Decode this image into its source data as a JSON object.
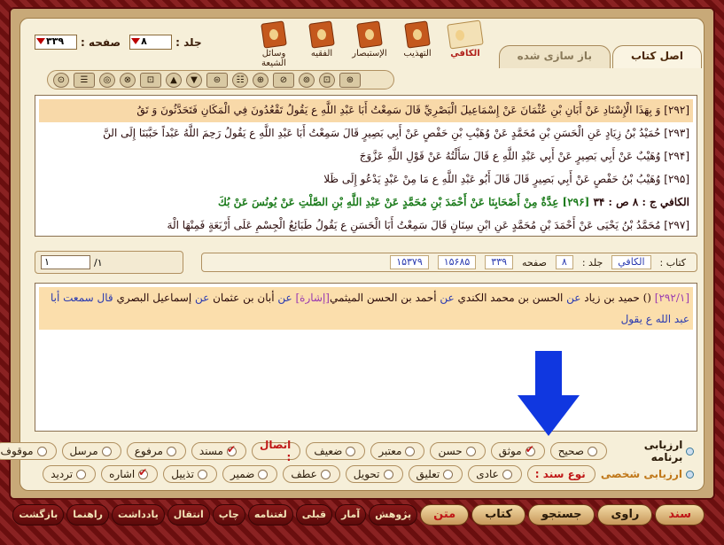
{
  "header": {
    "volume_label": "جلد :",
    "volume_value": "۸",
    "page_label": "صفحه :",
    "page_value": "۳۳۹",
    "books": [
      {
        "label": "الكافي",
        "active": true
      },
      {
        "label": "التهذيب",
        "active": false
      },
      {
        "label": "الإستبصار",
        "active": false
      },
      {
        "label": "الفقيه",
        "active": false
      },
      {
        "label": "وسائل الشيعة",
        "active": false
      }
    ],
    "tabs": [
      {
        "label": "اصل كتاب",
        "active": true
      },
      {
        "label": "باز سازی شده",
        "active": false
      }
    ]
  },
  "toolbar": {
    "buttons": [
      "⊙",
      "☰",
      "◎",
      "⊗",
      "⊡",
      "▲",
      "▼",
      "⊜",
      "☷",
      "⊕",
      "⊘",
      "⊚",
      "⊡",
      "⊛"
    ]
  },
  "hadith_lines": [
    {
      "num": "[۲۹۲]",
      "text": "وَ بِهَذَا الْإِسْنَادِ عَنْ أَبَانِ بْنِ عُثْمَانَ عَنْ إِسْمَاعِيلَ الْبَصْرِيِّ قَالَ سَمِعْتُ أَبَا عَبْدِ اللَّهِ ع يَقُولُ تَقْعُدُونَ فِي الْمَكَانِ فَتَحَدَّثُونَ وَ تَقُ",
      "style": "hl"
    },
    {
      "num": "[۲۹۳]",
      "text": "حُمَيْدُ بْنُ زِيَادٍ عَنِ الْحَسَنِ بْنِ مُحَمَّدٍ عَنْ وُهَيْبِ بْنِ حَفْصٍ عَنْ أَبِي بَصِيرٍ قَالَ سَمِعْتُ أَبَا عَبْدِ اللَّهِ ع يَقُولُ رَحِمَ اللَّهُ عَبْداً حَبَّبَنَا إِلَى النَّ",
      "style": ""
    },
    {
      "num": "[۲۹۴]",
      "text": "وُهَيْبٌ عَنْ أَبِي بَصِيرٍ عَنْ أَبِي عَبْدِ اللَّهِ ع قَالَ سَأَلْتُهُ عَنْ قَوْلِ اللَّهِ عَزَّوَجَ",
      "style": ""
    },
    {
      "num": "[۲۹۵]",
      "text": "وُهَيْبُ بْنُ حَفْصٍ عَنْ أَبِي بَصِيرٍ قَالَ قَالَ أَبُو عَبْدِ اللَّهِ ع مَا مِنْ عَبْدٍ يَدْعُو إِلَى ظَلا",
      "style": ""
    },
    {
      "num": "الكافي ج : ۸ ص : ۳۴",
      "text": "[۲۹۶] عِدَّةٌ مِنْ أَصْحَابِنَا عَنْ أَحْمَدَ بْنِ مُحَمَّدٍ عَنْ عَبْدِ اللَّهِ بْنِ الصَّلْتِ عَنْ يُونُسَ عَنْ بُكَ",
      "style": "kafi"
    },
    {
      "num": "[۲۹۷]",
      "text": "مُحَمَّدُ بْنُ يَحْيَى عَنْ أَحْمَدَ بْنِ مُحَمَّدٍ عَنِ ابْنِ سِنَانٍ قَالَ سَمِعْتُ أَبَا الْحَسَنِ ع يَقُولُ طَبَائِعُ الْجِسْمِ عَلَى أَرْبَعَةٍ فَمِنْهَا الْهَ",
      "style": ""
    }
  ],
  "pager": {
    "current": "۱",
    "total": "/۱"
  },
  "meta": {
    "book_label": "كتاب :",
    "book_value": "الكافي",
    "volume_label": "جلد :",
    "volume_value": "۸",
    "page_label": "صفحه",
    "page_value": "۳۳۹",
    "id_a": "۱۵۶۸۵",
    "id_b": "۱۵۳۷۹"
  },
  "chain": {
    "ref": "[۲۹۲/۱]",
    "segments": [
      {
        "text": " () ",
        "style": ""
      },
      {
        "text": "حميد بن زياد",
        "style": ""
      },
      {
        "text": " عن ",
        "style": "blue"
      },
      {
        "text": "الحسن بن محمد الكندي",
        "style": ""
      },
      {
        "text": " عن ",
        "style": "blue"
      },
      {
        "text": "أحمد بن الحسن الميثمي",
        "style": ""
      },
      {
        "text": "[إشارة]",
        "style": "purple"
      },
      {
        "text": " عن ",
        "style": "blue"
      },
      {
        "text": "أبان بن عثمان",
        "style": ""
      },
      {
        "text": " عن ",
        "style": "blue"
      },
      {
        "text": "إسماعيل البصري",
        "style": ""
      },
      {
        "text": " قال سمعت أبا عبد الله ع يقول",
        "style": "blue"
      }
    ]
  },
  "ratings_program": {
    "label": "ارزیابی برنامه",
    "items": [
      {
        "label": "صحيح",
        "checked": false
      },
      {
        "label": "موثق",
        "checked": true
      },
      {
        "label": "حسن",
        "checked": false
      },
      {
        "label": "معتبر",
        "checked": false
      },
      {
        "label": "ضعيف",
        "checked": false
      },
      {
        "label": "اتصال :",
        "checked": false,
        "group": true
      },
      {
        "label": "مسند",
        "checked": true
      },
      {
        "label": "مرفوع",
        "checked": false
      },
      {
        "label": "مرسل",
        "checked": false
      },
      {
        "label": "موقوف",
        "checked": false
      }
    ]
  },
  "ratings_personal": {
    "label": "ارزیابی شخصی",
    "items": [
      {
        "label": "نوع سند :",
        "checked": false,
        "group": true
      },
      {
        "label": "عادی",
        "checked": false
      },
      {
        "label": "تعليق",
        "checked": false
      },
      {
        "label": "تحويل",
        "checked": false
      },
      {
        "label": "عطف",
        "checked": false
      },
      {
        "label": "ضمير",
        "checked": false
      },
      {
        "label": "تذييل",
        "checked": false
      },
      {
        "label": "اشاره",
        "checked": true
      },
      {
        "label": "ترديد",
        "checked": false
      }
    ]
  },
  "bottom_buttons": [
    {
      "label": "سند",
      "style": "big red"
    },
    {
      "label": "راوی",
      "style": "big"
    },
    {
      "label": "جستجو",
      "style": "big"
    },
    {
      "label": "كتاب",
      "style": "big"
    },
    {
      "label": "متن",
      "style": "big red"
    },
    {
      "label": "پژوهش",
      "style": "dark"
    },
    {
      "label": "آمار",
      "style": "dark"
    },
    {
      "label": "قبلی",
      "style": "dark"
    },
    {
      "label": "لغتنامه",
      "style": "dark"
    },
    {
      "label": "چاپ",
      "style": "dark"
    },
    {
      "label": "انتقال",
      "style": "dark"
    },
    {
      "label": "يادداشت",
      "style": "dark"
    },
    {
      "label": "راهنما",
      "style": "dark"
    },
    {
      "label": "بازگشت",
      "style": "dark"
    }
  ]
}
